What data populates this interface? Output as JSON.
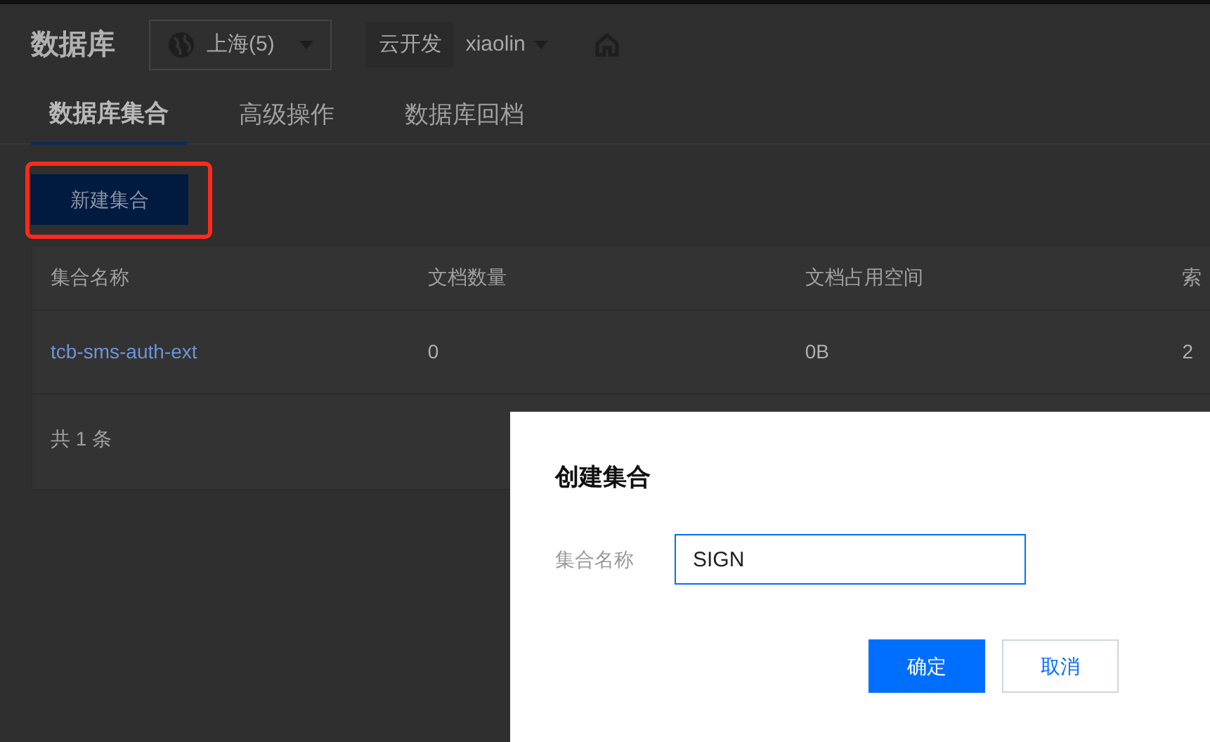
{
  "header": {
    "title": "数据库",
    "region": "上海(5)",
    "env_tag": "云开发",
    "env_name": "xiaolin"
  },
  "tabs": [
    {
      "label": "数据库集合",
      "selected": true
    },
    {
      "label": "高级操作",
      "selected": false
    },
    {
      "label": "数据库回档",
      "selected": false
    }
  ],
  "create_button": "新建集合",
  "table": {
    "columns": [
      "集合名称",
      "文档数量",
      "文档占用空间",
      "索"
    ],
    "rows": [
      [
        "tcb-sms-auth-ext",
        "0",
        "0B",
        "2"
      ]
    ],
    "footer": "共 1 条"
  },
  "dialog": {
    "title": "创建集合",
    "field_label": "集合名称",
    "field_value": "SIGN",
    "buttons": [
      {
        "label": "确定",
        "kind": "primary"
      },
      {
        "label": "取消",
        "kind": "secondary"
      }
    ]
  }
}
